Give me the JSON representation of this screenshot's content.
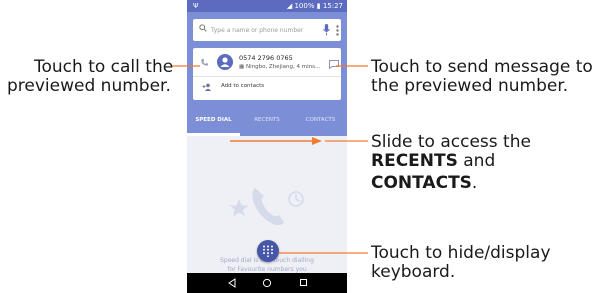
{
  "status_bar": {
    "battery": "100%",
    "time": "15:27"
  },
  "search": {
    "placeholder": "Type a name or phone number"
  },
  "preview_card": {
    "number": "0574 2796 0765",
    "location": "Ningbo, Zhejiang, 4 mins...",
    "add_contact_label": "Add to contacts"
  },
  "tabs": [
    {
      "label": "SPEED DIAL"
    },
    {
      "label": "RECENTS"
    },
    {
      "label": "CONTACTS"
    }
  ],
  "speed_dial": {
    "line1": "Speed dial is one touch dialling",
    "line2": "for Favourite     numbers you",
    "line3": "cal"
  },
  "annotations": {
    "call": {
      "line1": "Touch to call the",
      "line2": "previewed number."
    },
    "message": {
      "line1": "Touch to send message to",
      "line2": "the previewed number."
    },
    "slide": {
      "line1": "Slide to access the",
      "recents": "RECENTS",
      "and": " and",
      "contacts": "CONTACTS",
      "period": "."
    },
    "keyboard": {
      "line1": "Touch to hide/display",
      "line2": "keyboard."
    }
  },
  "colors": {
    "accent": "#7b8ed6",
    "status_bar": "#5c6bc0",
    "fab": "#4757a8",
    "arrow": "#f07c30"
  }
}
